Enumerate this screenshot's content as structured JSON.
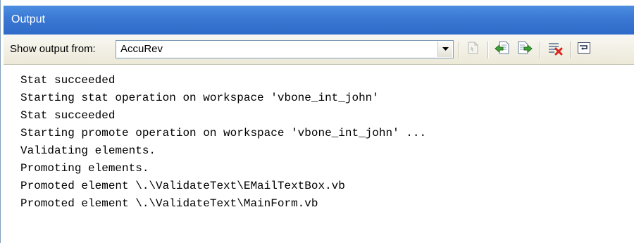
{
  "panel": {
    "title": "Output"
  },
  "toolbar": {
    "show_label": "Show output from:",
    "source_value": "AccuRev",
    "buttons": [
      {
        "icon": "find-message-icon",
        "enabled": false
      },
      {
        "icon": "go-to-previous-message-icon",
        "enabled": true
      },
      {
        "icon": "go-to-next-message-icon",
        "enabled": true
      },
      {
        "icon": "clear-all-icon",
        "enabled": true
      },
      {
        "icon": "toggle-word-wrap-icon",
        "enabled": true
      }
    ]
  },
  "output": {
    "lines": [
      "Stat succeeded",
      "Starting stat operation on workspace 'vbone_int_john'",
      "Stat succeeded",
      "Starting promote operation on workspace 'vbone_int_john' ...",
      "Validating elements.",
      "Promoting elements.",
      "Promoted element \\.\\ValidateText\\EMailTextBox.vb",
      "Promoted element \\.\\ValidateText\\MainForm.vb"
    ]
  },
  "colors": {
    "title_bar": "#3a78d4",
    "toolbar_bg": "#ece9d8",
    "text": "#000000"
  }
}
